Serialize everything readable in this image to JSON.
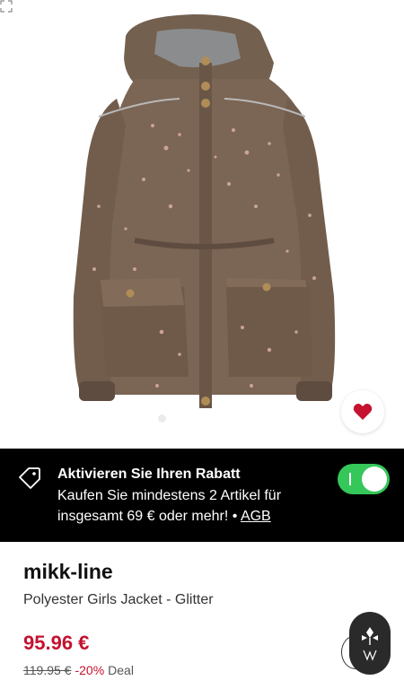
{
  "gallery": {
    "image_alt": "Brown parka jacket with metallic glitter dots",
    "dot_count": 6,
    "active_dot": 0,
    "colors": {
      "jacket": "#7b6554",
      "jacket_dark": "#5f4c40",
      "lining": "#8b8c8e",
      "glitter": "#d8b0a0"
    }
  },
  "favorite": {
    "icon": "heart-icon",
    "color": "#c4122f"
  },
  "promo": {
    "icon": "tag-icon",
    "title": "Aktivieren Sie Ihren Rabatt",
    "text": "Kaufen Sie mindestens 2 Artikel für insgesamt 69 € oder mehr! •",
    "link": "AGB",
    "toggle_on": true,
    "toggle_color": "#35c759"
  },
  "product": {
    "brand": "mikk-line",
    "name": "Polyester Girls Jacket - Glitter",
    "price": "95.96 €",
    "old_price": "119.95 €",
    "discount": "-20%",
    "deal_label": "Deal",
    "price_color": "#c4122f"
  },
  "assistant": {
    "icon": "assistant-logo-icon"
  }
}
